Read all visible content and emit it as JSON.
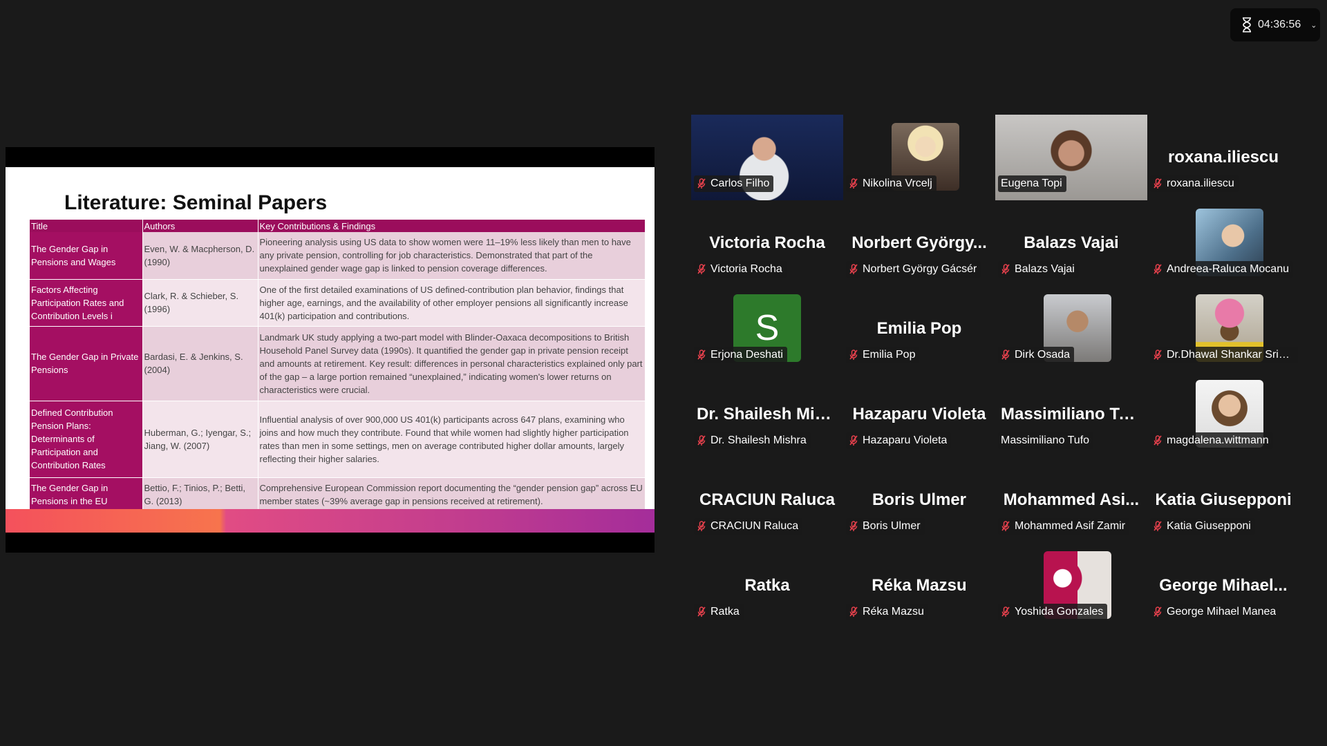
{
  "timer": {
    "elapsed": "04:36:56"
  },
  "slide": {
    "title": "Literature: Seminal Papers",
    "columns": [
      "Title",
      "Authors",
      "Key Contributions & Findings"
    ],
    "rows": [
      {
        "title": "The Gender Gap in Pensions and Wages",
        "authors": "Even, W. & Macpherson, D. (1990)",
        "findings": "Pioneering analysis using US data to show women were 11–19% less likely than men to have any private pension, controlling for job characteristics. Demonstrated that part of the unexplained gender wage gap is linked to pension coverage differences."
      },
      {
        "title": "Factors Affecting Participation Rates and Contribution Levels i",
        "authors": "Clark, R. & Schieber, S. (1996)",
        "findings": "One of the first detailed examinations of US defined-contribution plan behavior, findings that higher age, earnings, and the availability of other employer pensions all significantly increase 401(k) participation and contributions."
      },
      {
        "title": "The Gender Gap in Private Pensions",
        "authors": "Bardasi, E. & Jenkins, S. (2004)",
        "findings": "Landmark UK study applying a two-part model with Blinder-Oaxaca decompositions to British Household Panel Survey data (1990s). It quantified the gender gap in private pension receipt and amounts at retirement. Key result: differences in personal characteristics explained only part of the gap – a large portion remained “unexplained,” indicating women's lower returns on characteristics were crucial."
      },
      {
        "title": "Defined Contribution Pension Plans: Determinants of Participation and Contribution Rates",
        "authors": "Huberman, G.; Iyengar, S.; Jiang, W. (2007)",
        "findings": "Influential analysis of over 900,000 US 401(k) participants across 647 plans, examining who joins and how much they contribute. Found that while women had slightly higher participation rates than men in some settings, men on average contributed higher dollar amounts, largely reflecting their higher salaries."
      },
      {
        "title": "The Gender Gap in Pensions in the EU",
        "authors": "Bettio, F.; Tinios, P.; Betti, G. (2013)",
        "findings": "Comprehensive European Commission report documenting the “gender pension gap” across EU member states (~39% average gap in pensions received at retirement)."
      }
    ]
  },
  "participants": [
    {
      "label": "Carlos Filho",
      "type": "video",
      "muted": true
    },
    {
      "label": "Nikolina Vrcelj",
      "type": "photo",
      "muted": true
    },
    {
      "label": "Eugena Topi",
      "type": "video",
      "muted": false,
      "active": true
    },
    {
      "label": "roxana.iliescu",
      "display": "roxana.iliescu",
      "type": "name",
      "muted": true
    },
    {
      "label": "Victoria Rocha",
      "display": "Victoria Rocha",
      "type": "name",
      "muted": true
    },
    {
      "label": "Norbert György Gácsér",
      "display": "Norbert György...",
      "type": "name",
      "muted": true
    },
    {
      "label": "Balazs Vajai",
      "display": "Balazs Vajai",
      "type": "name",
      "muted": true
    },
    {
      "label": "Andreea-Raluca Mocanu",
      "type": "photo",
      "muted": true
    },
    {
      "label": "Erjona Deshati",
      "type": "initial",
      "initial": "S",
      "muted": true
    },
    {
      "label": "Emilia Pop",
      "display": "Emilia Pop",
      "type": "name",
      "muted": true
    },
    {
      "label": "Dirk Osada",
      "type": "photo",
      "muted": true
    },
    {
      "label": "Dr.Dhawal Shankar Srivas...",
      "type": "photo",
      "muted": true
    },
    {
      "label": "Dr. Shailesh Mishra",
      "display": "Dr. Shailesh Mis...",
      "type": "name",
      "muted": true
    },
    {
      "label": "Hazaparu Violeta",
      "display": "Hazaparu Violeta",
      "type": "name",
      "muted": true
    },
    {
      "label": "Massimiliano Tufo",
      "display": "Massimiliano Tu...",
      "type": "name",
      "muted": false
    },
    {
      "label": "magdalena.wittmann",
      "type": "photo",
      "muted": true
    },
    {
      "label": "CRACIUN Raluca",
      "display": "CRACIUN Raluca",
      "type": "name",
      "muted": true
    },
    {
      "label": "Boris Ulmer",
      "display": "Boris Ulmer",
      "type": "name",
      "muted": true
    },
    {
      "label": "Mohammed Asif Zamir",
      "display": "Mohammed Asi...",
      "type": "name",
      "muted": true
    },
    {
      "label": "Katia Giusepponi",
      "display": "Katia Giusepponi",
      "type": "name",
      "muted": true
    },
    {
      "label": "Ratka",
      "display": "Ratka",
      "type": "name",
      "muted": true
    },
    {
      "label": "Réka Mazsu",
      "display": "Réka Mazsu",
      "type": "name",
      "muted": true
    },
    {
      "label": "Yoshida Gonzales",
      "type": "photo",
      "muted": true
    },
    {
      "label": "George Mihael Manea",
      "display": "George Mihael...",
      "type": "name",
      "muted": true
    }
  ]
}
